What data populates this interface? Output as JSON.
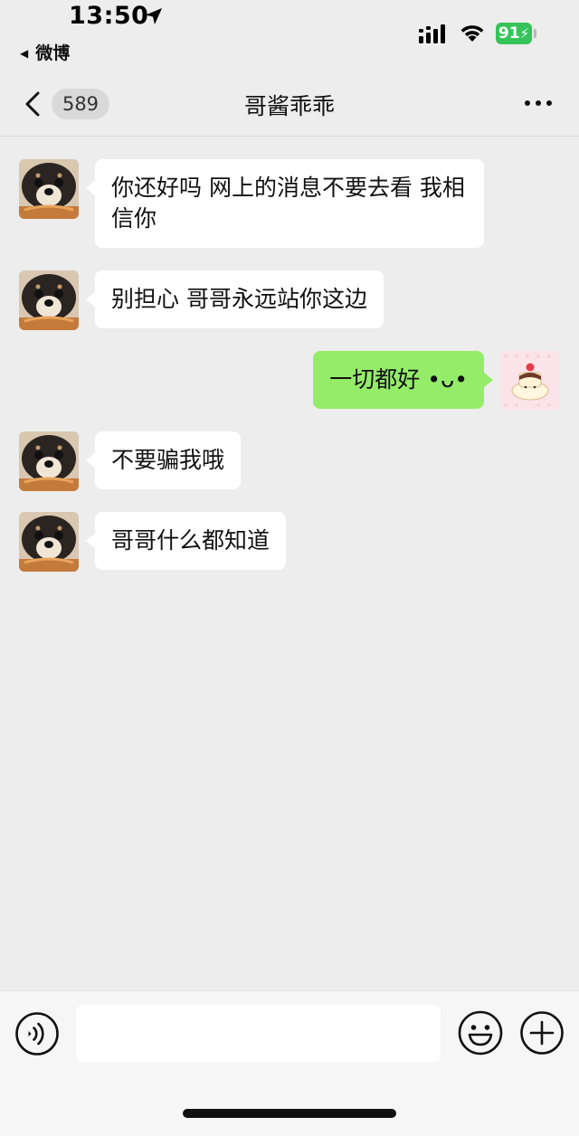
{
  "status_bar": {
    "time": "13:50",
    "back_app": "微博",
    "battery": "91"
  },
  "nav": {
    "unread_count": "589",
    "title": "哥酱乖乖"
  },
  "messages": [
    {
      "from": "other",
      "text": "你还好吗 网上的消息不要去看 我相信你",
      "avatar": "shiba-dog-avatar"
    },
    {
      "from": "other",
      "text": "别担心 哥哥永远站你这边",
      "avatar": "shiba-dog-avatar"
    },
    {
      "from": "self",
      "text": "一切都好 •ᴗ•",
      "avatar": "cake-pudding-avatar"
    },
    {
      "from": "other",
      "text": "不要骗我哦",
      "avatar": "shiba-dog-avatar"
    },
    {
      "from": "other",
      "text": "哥哥什么都知道",
      "avatar": "shiba-dog-avatar"
    }
  ],
  "input": {
    "value": "",
    "placeholder": ""
  },
  "colors": {
    "background": "#ededed",
    "incoming_bubble": "#ffffff",
    "outgoing_bubble": "#95ec69",
    "battery": "#36c45a"
  },
  "icons": {
    "location": "location-arrow-icon",
    "signal": "cellular-signal-icon",
    "wifi": "wifi-icon",
    "back": "chevron-left-icon",
    "more": "more-dots-icon",
    "voice": "voice-icon",
    "emoji": "emoji-icon",
    "add": "plus-circle-icon"
  }
}
